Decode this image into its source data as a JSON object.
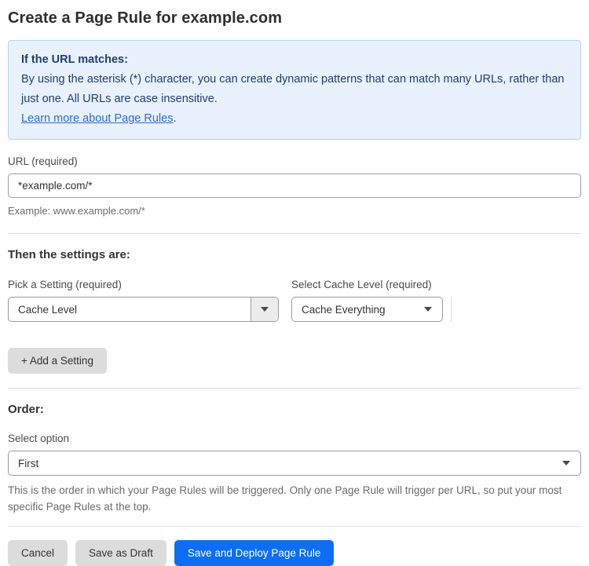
{
  "page": {
    "title": "Create a Page Rule for example.com"
  },
  "info_box": {
    "heading": "If the URL matches:",
    "body": "By using the asterisk (*) character, you can create dynamic patterns that can match many URLs, rather than just one. All URLs are case insensitive.",
    "link_label": "Learn more about Page Rules",
    "link_suffix": "."
  },
  "url_field": {
    "label": "URL (required)",
    "value": "*example.com/*",
    "help": "Example: www.example.com/*"
  },
  "settings_section": {
    "heading": "Then the settings are:",
    "setting_picker": {
      "label": "Pick a Setting (required)",
      "value": "Cache Level"
    },
    "cache_level_picker": {
      "label": "Select Cache Level (required)",
      "value": "Cache Everything"
    },
    "add_setting_label": "+ Add a Setting"
  },
  "order_section": {
    "heading": "Order:",
    "select_label": "Select option",
    "value": "First",
    "help": "This is the order in which your Page Rules will be triggered. Only one Page Rule will trigger per URL, so put your most specific Page Rules at the top."
  },
  "footer": {
    "cancel_label": "Cancel",
    "save_draft_label": "Save as Draft",
    "save_deploy_label": "Save and Deploy Page Rule"
  },
  "colors": {
    "info_background": "#e8f1fc",
    "info_border": "#b9d4f1",
    "info_text": "#1f3e75",
    "link": "#2f6bd8",
    "primary_button": "#0d6ef5",
    "gray_button": "#dcdcdc"
  },
  "icons": {
    "dropdown_arrow": "chevron-down"
  }
}
